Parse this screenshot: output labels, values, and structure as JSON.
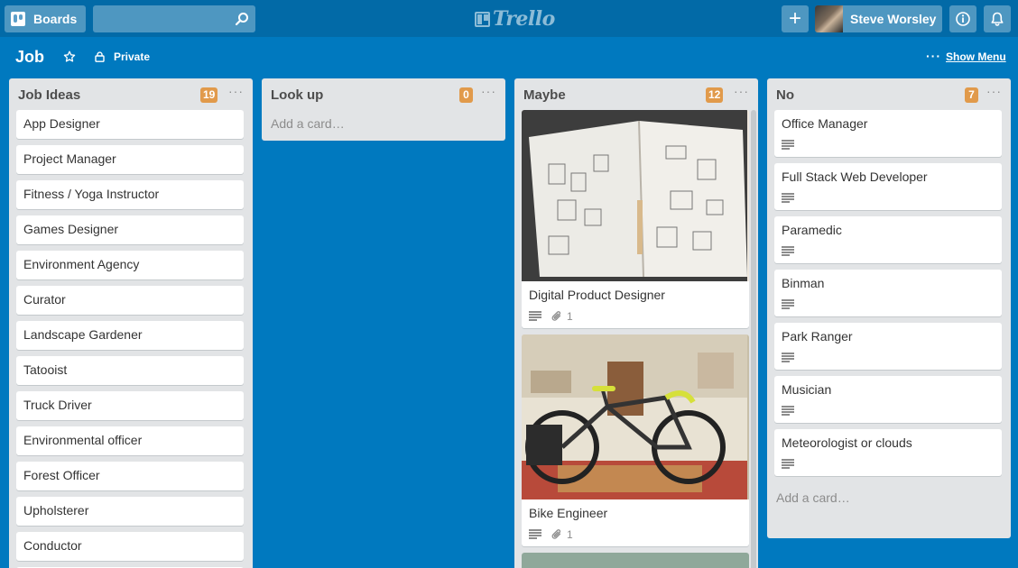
{
  "header": {
    "boards_label": "Boards",
    "logo_text": "Trello",
    "user_name": "Steve Worsley",
    "plus_label": "+"
  },
  "board": {
    "title": "Job",
    "visibility": "Private",
    "menu_dots": "···",
    "show_menu_label": "Show Menu"
  },
  "colors": {
    "board_bg": "#0079bf",
    "header_bg": "#026aa7",
    "count_badge": "#e19a4b",
    "list_bg": "#e2e4e6"
  },
  "icons": [
    "boards-icon",
    "search-icon",
    "trello-logo-icon",
    "plus-icon",
    "info-icon",
    "bell-icon",
    "star-icon",
    "lock-icon",
    "description-icon",
    "attachment-icon"
  ],
  "lists": [
    {
      "name": "Job Ideas",
      "count": "19",
      "dots": "···",
      "cards": [
        "App Designer",
        "Project Manager",
        "Fitness / Yoga Instructor",
        "Games Designer",
        "Environment Agency",
        "Curator",
        "Landscape Gardener",
        "Tatooist",
        "Truck Driver",
        "Environmental officer",
        "Forest Officer",
        "Upholsterer",
        "Conductor"
      ]
    },
    {
      "name": "Look up",
      "count": "0",
      "dots": "···",
      "add_card": "Add a card…"
    },
    {
      "name": "Maybe",
      "count": "12",
      "dots": "···",
      "cards": [
        {
          "title": "Digital Product Designer",
          "attachments": "1"
        },
        {
          "title": "Bike Engineer",
          "attachments": "1"
        }
      ]
    },
    {
      "name": "No",
      "count": "7",
      "dots": "···",
      "cards": [
        "Office Manager",
        "Full Stack Web Developer",
        "Paramedic",
        "Binman",
        "Park Ranger",
        "Musician",
        "Meteorologist or clouds"
      ],
      "add_card": "Add a card…"
    }
  ]
}
